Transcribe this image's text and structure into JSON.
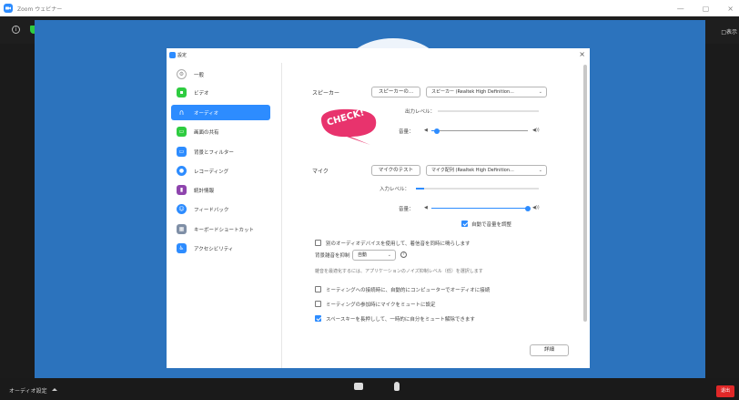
{
  "window": {
    "title": "Zoom ウェビナー",
    "controls": [
      "—",
      "▢",
      "×"
    ]
  },
  "meeting": {
    "gallery_label": "□表示",
    "audio_settings_label": "オーディオ設定",
    "end_label": "退出"
  },
  "settings": {
    "title": "設定",
    "close": "×",
    "sidebar": [
      {
        "label": "一般",
        "icon": "gear-icon",
        "color": "#ffffff",
        "symbol": "⚙"
      },
      {
        "label": "ビデオ",
        "icon": "video-icon",
        "color": "#2ecc40",
        "symbol": ""
      },
      {
        "label": "オーディオ",
        "icon": "headphones-icon",
        "color": "#2d8cff",
        "symbol": "∩",
        "active": true
      },
      {
        "label": "画面の共有",
        "icon": "share-screen-icon",
        "color": "#2ecc40",
        "symbol": "▭"
      },
      {
        "label": "背景とフィルター",
        "icon": "background-icon",
        "color": "#2d8cff",
        "symbol": "▭"
      },
      {
        "label": "レコーディング",
        "icon": "record-icon",
        "color": "#2d8cff",
        "symbol": "●"
      },
      {
        "label": "統計情報",
        "icon": "statistics-icon",
        "color": "#8e44ad",
        "symbol": "▮"
      },
      {
        "label": "フィードバック",
        "icon": "feedback-icon",
        "color": "#2d8cff",
        "symbol": "☺"
      },
      {
        "label": "キーボードショートカット",
        "icon": "keyboard-icon",
        "color": "#7f8fa6",
        "symbol": "▦"
      },
      {
        "label": "アクセシビリティ",
        "icon": "accessibility-icon",
        "color": "#2d8cff",
        "symbol": "♿"
      }
    ],
    "speaker": {
      "label": "スピーカー",
      "test_button": "スピーカーの...",
      "device": "スピーカー (Realtek High Definition...",
      "output_level_label": "出力レベル：",
      "output_level": 0.0,
      "volume_label": "音量：",
      "volume": 0.06
    },
    "mic": {
      "label": "マイク",
      "test_button": "マイクのテスト",
      "device": "マイク配列 (Realtek High Definition...",
      "input_level_label": "入力レベル：",
      "input_level": 0.07,
      "volume_label": "音量：",
      "volume": 1.0,
      "auto_adjust_label": "自動で音量を調整",
      "auto_adjust": true
    },
    "separate_device_label": "別のオーディオデバイスを使用して、着信音を同時に鳴らします",
    "separate_device": false,
    "noise_label": "背景雑音を抑制",
    "noise_value": "自動",
    "noise_hint": "雑音を最適化するには、アプリケーションのノイズ抑制レベル（低）を選択します",
    "options": [
      {
        "label": "ミーティングへの接続時に、自動的にコンピューターでオーディオに接続",
        "checked": false
      },
      {
        "label": "ミーティングの参加時にマイクをミュートに設定",
        "checked": false
      },
      {
        "label": "スペースキーを長押しして、一時的に自分をミュート解除できます",
        "checked": true
      }
    ],
    "advanced_button": "詳細"
  },
  "annotation": {
    "text": "CHECK!",
    "color": "#e8336d"
  }
}
